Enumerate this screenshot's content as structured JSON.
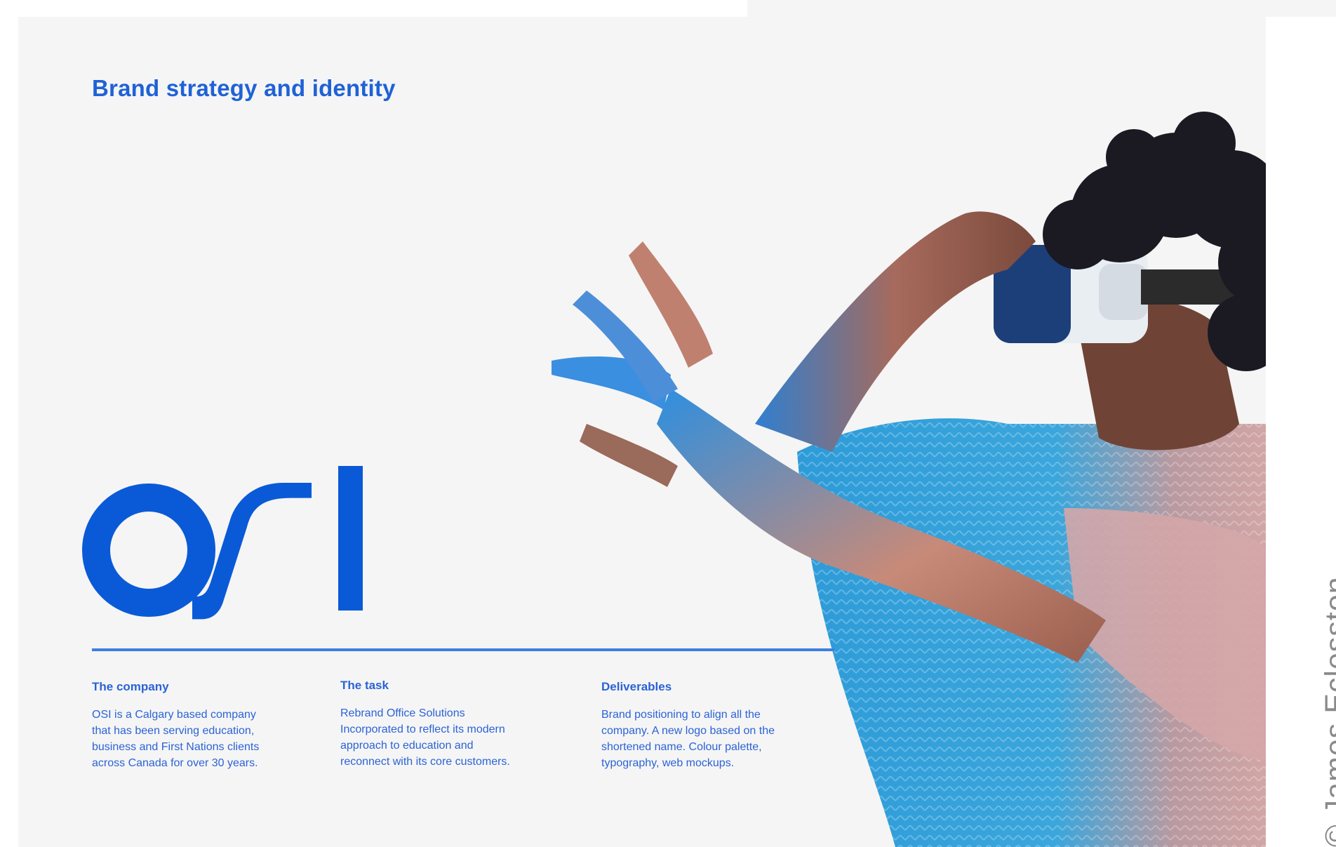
{
  "brand_title": "Brand strategy and identity",
  "logo": {
    "text": "OSI",
    "color": "#0a5ad7"
  },
  "columns": [
    {
      "heading": "The company",
      "lines": [
        "OSI is a Calgary based company",
        "that has been serving education,",
        "business and First Nations clients",
        "across Canada for over 30 years."
      ]
    },
    {
      "heading": "The task",
      "lines": [
        "Rebrand Office Solutions",
        "Incorporated to reflect its modern",
        "approach to education and",
        "reconnect with its core customers."
      ]
    },
    {
      "heading": "Deliverables",
      "lines": [
        "Brand positioning to align all the",
        "company. A new logo based on the",
        "shortened name. Colour palette,",
        "typography, web mockups."
      ]
    }
  ],
  "credit": "© James Eclesston",
  "accent_color": "#1f62d6"
}
